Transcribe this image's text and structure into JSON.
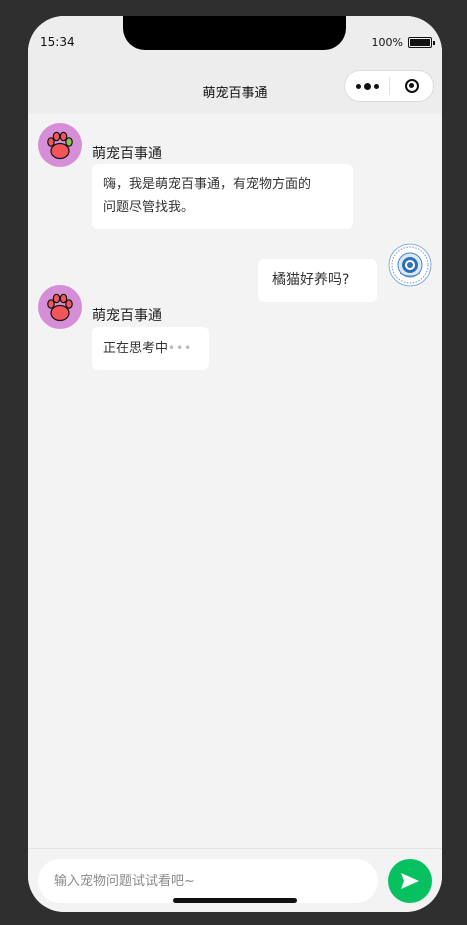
{
  "status": {
    "time": "15:34",
    "battery": "100%"
  },
  "nav": {
    "title": "萌宠百事通"
  },
  "messages": [
    {
      "role": "bot",
      "sender": "萌宠百事通",
      "text_line1": "嗨，我是萌宠百事通，有宠物方面的",
      "text_line2": "问题尽管找我。"
    },
    {
      "role": "user",
      "text": "橘猫好养吗?"
    },
    {
      "role": "bot",
      "sender": "萌宠百事通",
      "text": "正在思考中",
      "typing": "•••"
    }
  ],
  "input": {
    "placeholder": "输入宠物问题试试看吧~"
  },
  "colors": {
    "send": "#07c160",
    "bot_avatar": "#d68fd6",
    "paw": "#f2555a",
    "paw_accent": "#8bc34a"
  }
}
